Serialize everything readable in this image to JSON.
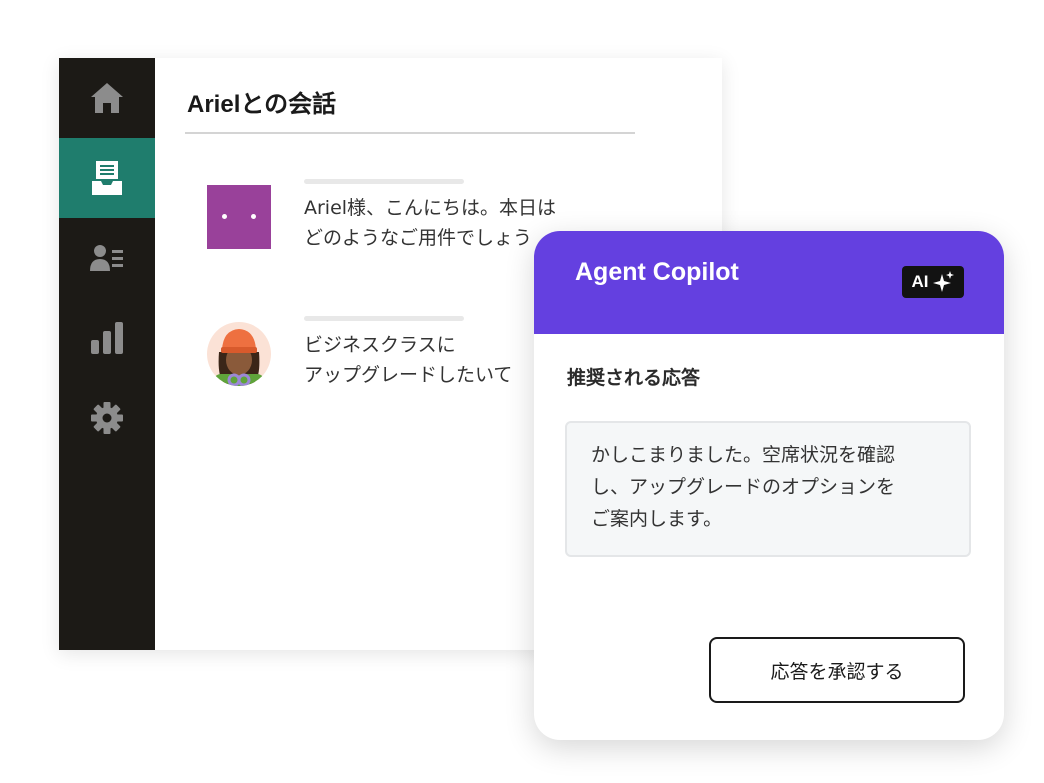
{
  "nav": {
    "items": [
      {
        "icon": "home-icon"
      },
      {
        "icon": "inbox-icon",
        "active": true
      },
      {
        "icon": "contacts-icon"
      },
      {
        "icon": "analytics-icon"
      },
      {
        "icon": "settings-icon"
      }
    ]
  },
  "conversation": {
    "title": "Arielとの会話",
    "messages": [
      {
        "sender": "bot",
        "text": "Ariel様、こんにちは。本日は\nどのようなご用件でしょう"
      },
      {
        "sender": "customer",
        "text": "ビジネスクラスに\nアップグレードしたいて"
      }
    ]
  },
  "copilot": {
    "title": "Agent Copilot",
    "badge": "AI",
    "section_label": "推奨される応答",
    "suggested_reply": "かしこまりました。空席状況を確認\nし、アップグレードのオプションを\nご案内します。",
    "approve_label": "応答を承認する"
  },
  "colors": {
    "sidebar": "#1c1a16",
    "sidebar_active": "#1f7d6d",
    "bot_avatar": "#99419a",
    "copilot_header": "#6440e0"
  }
}
